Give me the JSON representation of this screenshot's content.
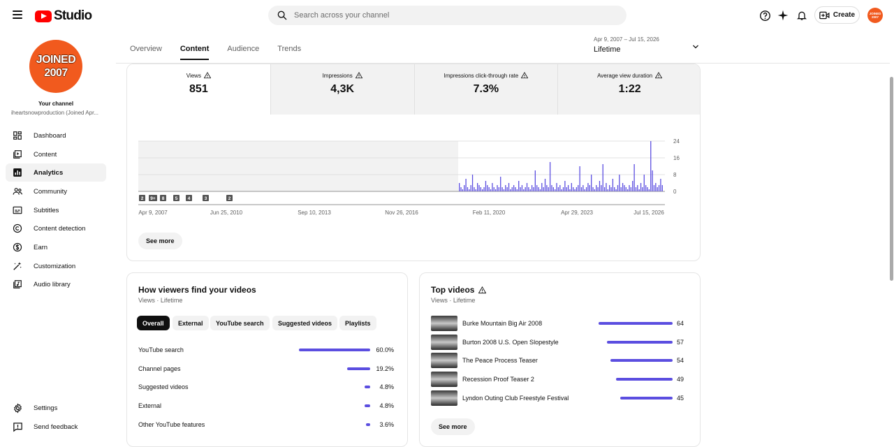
{
  "app": {
    "logo_text": "Studio"
  },
  "search": {
    "placeholder": "Search across your channel"
  },
  "header": {
    "create_label": "Create",
    "avatar_text": "JOINED 2007"
  },
  "channel": {
    "avatar_line1": "JOINED",
    "avatar_line2": "2007",
    "your_channel": "Your channel",
    "name": "iheartsnowproduction (Joined Apr..."
  },
  "sidebar": {
    "items": [
      {
        "label": "Dashboard",
        "icon": "dashboard-icon"
      },
      {
        "label": "Content",
        "icon": "content-icon"
      },
      {
        "label": "Analytics",
        "icon": "analytics-icon",
        "active": true
      },
      {
        "label": "Community",
        "icon": "community-icon"
      },
      {
        "label": "Subtitles",
        "icon": "subtitles-icon"
      },
      {
        "label": "Content detection",
        "icon": "copyright-icon"
      },
      {
        "label": "Earn",
        "icon": "dollar-icon"
      },
      {
        "label": "Customization",
        "icon": "magic-wand-icon"
      },
      {
        "label": "Audio library",
        "icon": "audio-library-icon"
      }
    ],
    "bottom": [
      {
        "label": "Settings",
        "icon": "gear-icon"
      },
      {
        "label": "Send feedback",
        "icon": "feedback-icon"
      }
    ]
  },
  "tabs": [
    "Overview",
    "Content",
    "Audience",
    "Trends"
  ],
  "active_tab": "Content",
  "date": {
    "range": "Apr 9, 2007 – Jul 15, 2026",
    "label": "Lifetime"
  },
  "metrics": [
    {
      "label": "Views",
      "value": "851"
    },
    {
      "label": "Impressions",
      "value": "4,3K"
    },
    {
      "label": "Impressions click-through rate",
      "value": "7.3%"
    },
    {
      "label": "Average view duration",
      "value": "1:22"
    }
  ],
  "chart_data": {
    "type": "bar",
    "x_tick_labels": [
      "Apr 9, 2007",
      "Jun 25, 2010",
      "Sep 10, 2013",
      "Nov 26, 2016",
      "Feb 11, 2020",
      "Apr 29, 2023",
      "Jul 15, 2026"
    ],
    "y_tick_labels": [
      "24",
      "16",
      "8",
      "0"
    ],
    "ylim": [
      0,
      24
    ],
    "grid": true,
    "markers": [
      "2",
      "9+",
      "8",
      "5",
      "4",
      "3",
      "2"
    ],
    "series": [
      {
        "values": [
          4,
          2,
          1,
          3,
          6,
          2,
          1,
          3,
          8,
          2,
          1,
          4,
          3,
          2,
          1,
          2,
          5,
          3,
          2,
          1,
          4,
          2,
          1,
          3,
          2,
          7,
          2,
          1,
          3,
          2,
          4,
          1,
          2,
          3,
          2,
          1,
          5,
          2,
          3,
          1,
          2,
          4,
          2,
          1,
          3,
          2,
          10,
          3,
          2,
          1,
          4,
          2,
          6,
          3,
          2,
          14,
          3,
          2,
          1,
          4,
          2,
          3,
          1,
          2,
          5,
          2,
          3,
          1,
          4,
          2,
          1,
          2,
          3,
          12,
          2,
          3,
          1,
          2,
          4,
          3,
          8,
          2,
          1,
          3,
          2,
          5,
          3,
          13,
          2,
          4,
          1,
          3,
          2,
          6,
          2,
          1,
          3,
          8,
          2,
          4,
          3,
          2,
          1,
          3,
          2,
          5,
          13,
          2,
          3,
          1,
          4,
          2,
          8,
          3,
          2,
          1,
          24,
          10,
          3,
          4,
          2,
          3,
          6,
          3
        ]
      }
    ]
  },
  "chart_see_more": "See more",
  "traffic": {
    "title": "How viewers find your videos",
    "subtitle": "Views · Lifetime",
    "chips": [
      "Overall",
      "External",
      "YouTube search",
      "Suggested videos",
      "Playlists"
    ],
    "rows": [
      {
        "label": "YouTube search",
        "value": "60.0%",
        "fraction": 0.6
      },
      {
        "label": "Channel pages",
        "value": "19.2%",
        "fraction": 0.192
      },
      {
        "label": "Suggested videos",
        "value": "4.8%",
        "fraction": 0.048
      },
      {
        "label": "External",
        "value": "4.8%",
        "fraction": 0.048
      },
      {
        "label": "Other YouTube features",
        "value": "3.6%",
        "fraction": 0.036
      }
    ]
  },
  "top_videos": {
    "title": "Top videos",
    "subtitle": "Views · Lifetime",
    "rows": [
      {
        "title": "Burke Mountain Big Air 2008",
        "value": "64",
        "views": 64
      },
      {
        "title": "Burton 2008 U.S. Open Slopestyle",
        "value": "57",
        "views": 57
      },
      {
        "title": "The Peace Process Teaser",
        "value": "54",
        "views": 54
      },
      {
        "title": "Recession Proof Teaser 2",
        "value": "49",
        "views": 49
      },
      {
        "title": "Lyndon Outing Club Freestyle Festival",
        "value": "45",
        "views": 45
      }
    ],
    "see_more": "See more"
  },
  "colors": {
    "accent": "#5b4ee0",
    "avatar": "#f15a1e",
    "logo_red": "#ff0000"
  }
}
